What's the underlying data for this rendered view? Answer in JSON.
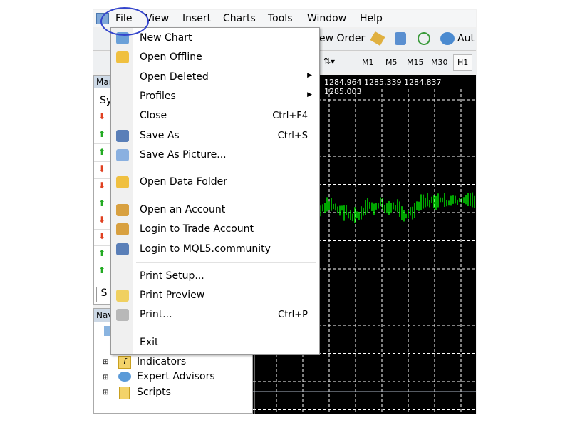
{
  "menubar": {
    "items": [
      "File",
      "View",
      "Insert",
      "Charts",
      "Tools",
      "Window",
      "Help"
    ]
  },
  "toolbar": {
    "new_order": "ew Order",
    "auto": "Aut",
    "timeframes": [
      "M1",
      "M5",
      "M15",
      "M30",
      "H1"
    ]
  },
  "chart": {
    "prices": "1284.964 1285.339 1284.837 1285.003",
    "line_color": "#00ff00",
    "grid_color": "#ffffff"
  },
  "market_watch": {
    "title": "Mar",
    "col": "Sy",
    "tab": "S",
    "arrows": [
      "down",
      "up",
      "up",
      "down",
      "down",
      "up",
      "down",
      "down",
      "up",
      "up"
    ]
  },
  "navigator": {
    "title": "Nav",
    "items": [
      "Indicators",
      "Expert Advisors",
      "Scripts"
    ]
  },
  "file_menu": {
    "items": [
      {
        "label": "New Chart",
        "icon": "new-chart-icon"
      },
      {
        "label": "Open Offline",
        "icon": "folder-open-icon"
      },
      {
        "label": "Open Deleted",
        "submenu": true
      },
      {
        "label": "Profiles",
        "submenu": true
      },
      {
        "label": "Close",
        "shortcut": "Ctrl+F4"
      },
      {
        "label": "Save As",
        "shortcut": "Ctrl+S",
        "icon": "save-icon"
      },
      {
        "label": "Save As Picture...",
        "icon": "picture-icon"
      },
      {
        "label": "Open Data Folder",
        "icon": "folder-icon"
      },
      {
        "label": "Open an Account",
        "icon": "user-add-icon"
      },
      {
        "label": "Login to Trade Account",
        "icon": "user-login-icon"
      },
      {
        "label": "Login to MQL5.community",
        "icon": "mql5-icon"
      },
      {
        "label": "Print Setup..."
      },
      {
        "label": "Print Preview",
        "icon": "print-preview-icon"
      },
      {
        "label": "Print...",
        "shortcut": "Ctrl+P",
        "icon": "printer-icon"
      },
      {
        "label": "Exit"
      }
    ]
  },
  "highlight_color": "#3344cc"
}
